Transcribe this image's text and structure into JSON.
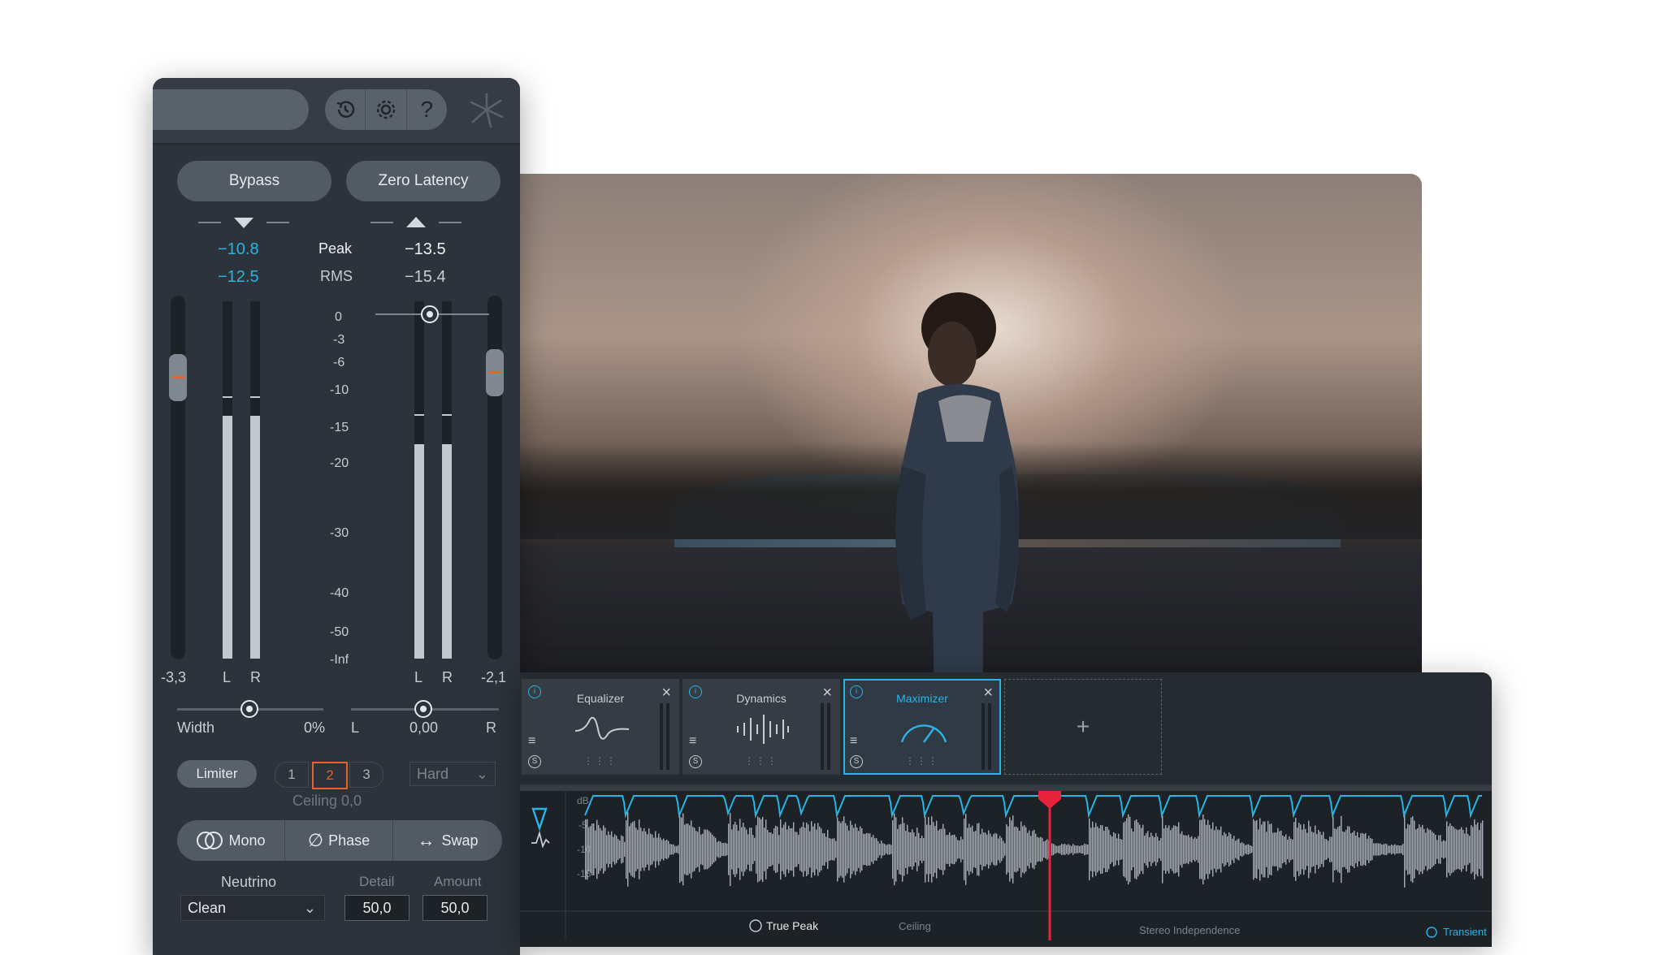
{
  "colors": {
    "accent": "#2ab3e6",
    "playhead": "#e8233c",
    "fader_mark": "#e5622a"
  },
  "topbar": {
    "icons": [
      "history-icon",
      "gear-icon",
      "help-icon",
      "ozone-logo-icon"
    ],
    "help_glyph": "?"
  },
  "buttons": {
    "bypass": "Bypass",
    "zero_latency": "Zero Latency"
  },
  "meters": {
    "input": {
      "peak": "−10.8",
      "rms": "−12.5",
      "fader": "-3,3",
      "peak_level": 0.68,
      "peak_hold": 0.73
    },
    "output": {
      "peak": "−13.5",
      "rms": "−15.4",
      "fader": "-2,1",
      "peak_level": 0.6,
      "peak_hold": 0.68
    },
    "peak_label": "Peak",
    "rms_label": "RMS",
    "channel_l": "L",
    "channel_r": "R",
    "scale": [
      "0",
      "-3",
      "-6",
      "-10",
      "-15",
      "-20",
      "-30",
      "-40",
      "-50",
      "-Inf"
    ]
  },
  "width": {
    "label": "Width",
    "value": "0%"
  },
  "balance": {
    "left": "L",
    "value": "0,00",
    "right": "R"
  },
  "limiter": {
    "label": "Limiter",
    "modes": [
      "1",
      "2",
      "3"
    ],
    "selected_mode": "2",
    "style": "Hard",
    "ceiling": "Ceiling 0,0"
  },
  "stereo_buttons": {
    "mono": "Mono",
    "phase": "Phase",
    "swap": "Swap"
  },
  "neutrino": {
    "label": "Neutrino",
    "mode": "Clean",
    "detail_label": "Detail",
    "detail": "50,0",
    "amount_label": "Amount",
    "amount": "50,0"
  },
  "chain": {
    "modules": [
      {
        "name": "Equalizer",
        "active": false
      },
      {
        "name": "Dynamics",
        "active": false
      },
      {
        "name": "Maximizer",
        "active": true
      }
    ],
    "add_label": "+"
  },
  "waveform": {
    "db_scale": [
      "dB",
      "-5",
      "-10",
      "-15"
    ],
    "footer": {
      "true_peak": "True Peak",
      "ceiling": "Ceiling",
      "stereo_independence": "Stereo Independence",
      "transient": "Transient"
    }
  }
}
